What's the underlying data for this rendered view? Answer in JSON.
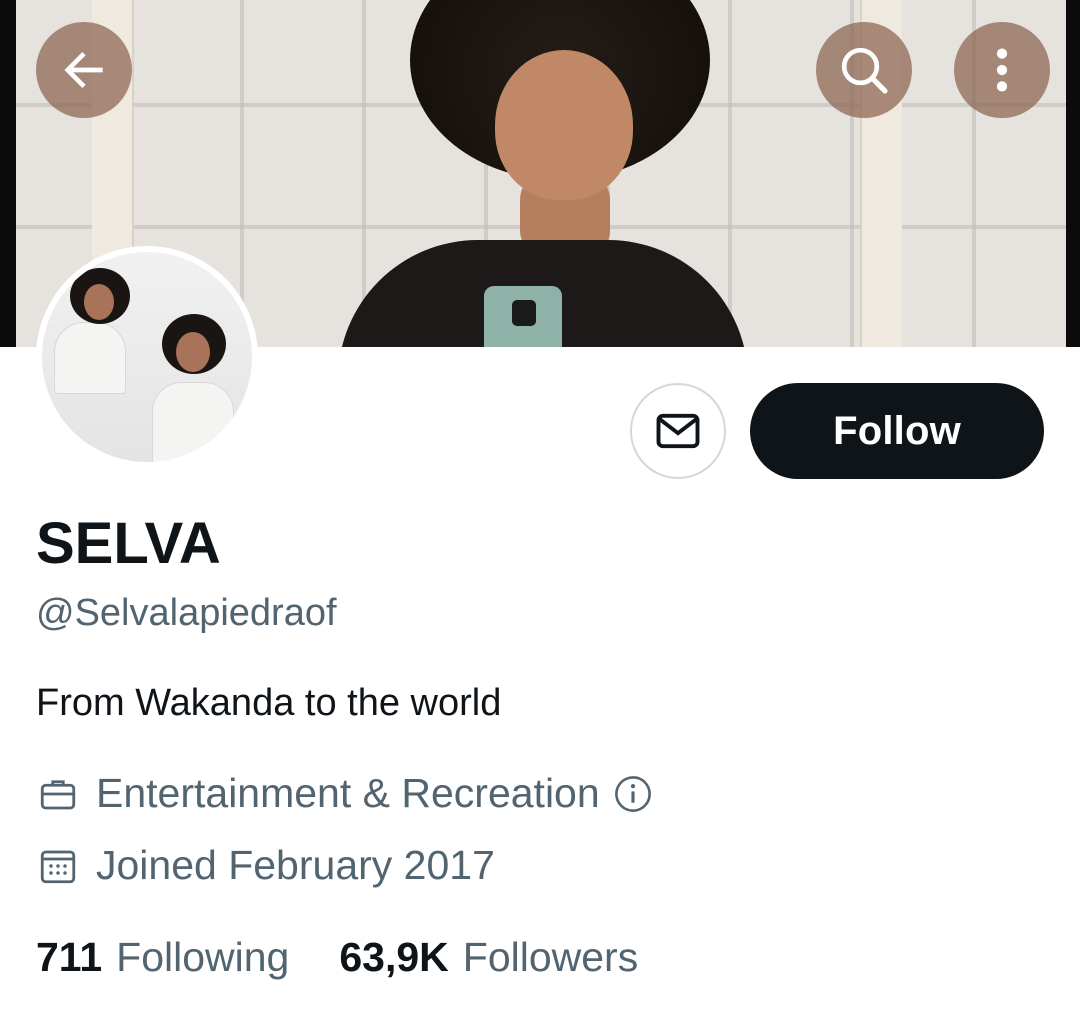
{
  "profile": {
    "name": "SELVA",
    "handle": "@Selvalapiedraof",
    "bio": "From Wakanda to the world",
    "category": "Entertainment & Recreation",
    "joined": "Joined February 2017"
  },
  "actions": {
    "follow_label": "Follow"
  },
  "stats": {
    "following_count": "711",
    "following_label": "Following",
    "followers_count": "63,9K",
    "followers_label": "Followers"
  },
  "icons": {
    "back": "arrow-left-icon",
    "search": "search-icon",
    "more": "more-vertical-icon",
    "message": "envelope-icon",
    "category": "briefcase-icon",
    "category_info": "info-icon",
    "joined": "calendar-icon"
  },
  "colors": {
    "primary_text": "#0f1419",
    "secondary_text": "#536471",
    "follow_bg": "#0f1419",
    "follow_text": "#ffffff",
    "overlay_button": "#8c6450"
  }
}
